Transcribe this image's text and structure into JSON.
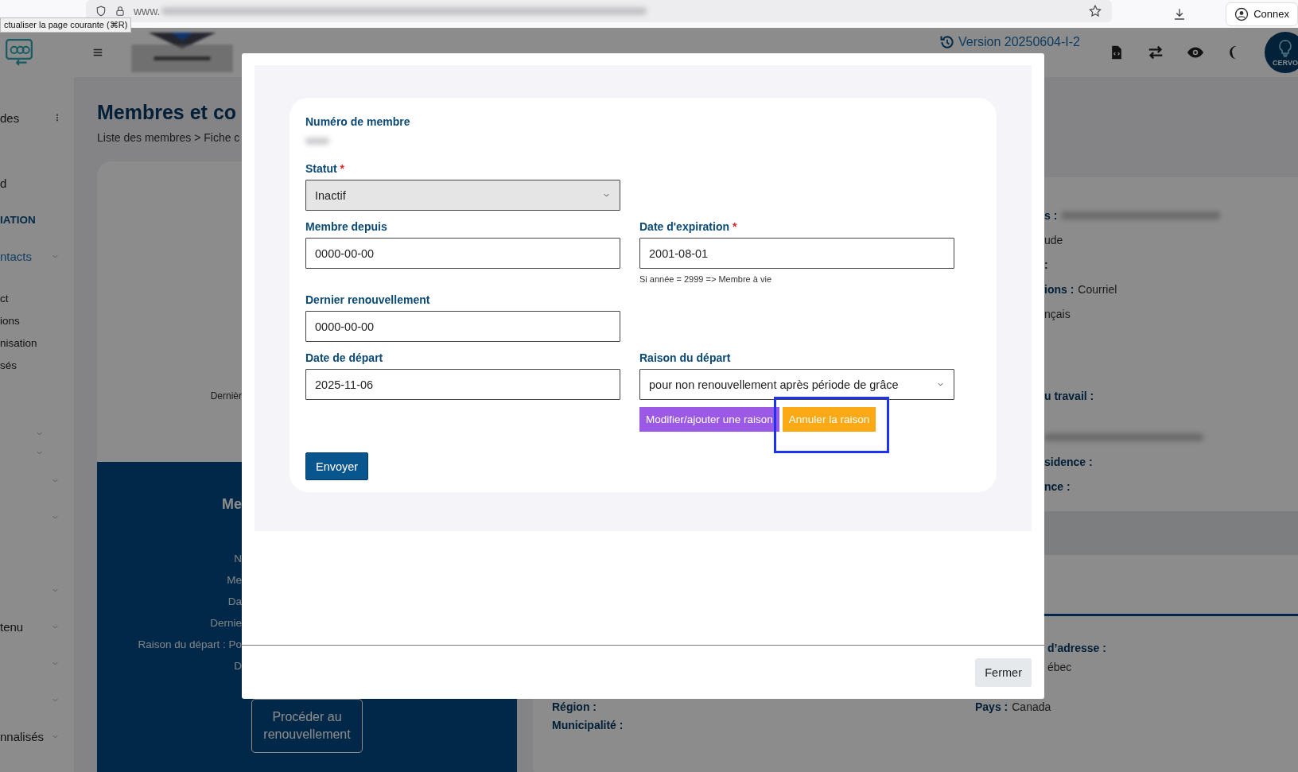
{
  "browser": {
    "url_prefix": "www.",
    "tooltip": "ctualiser la page courante (⌘R)",
    "profile_label": "Connex"
  },
  "header": {
    "version": "Version 20250604-I-2",
    "avatar_label": "CERVO"
  },
  "sidebar": {
    "items": [
      {
        "kind": "menu",
        "label": "des",
        "more": true
      },
      {
        "kind": "item",
        "label": "d"
      },
      {
        "kind": "section",
        "label": "IATION"
      },
      {
        "kind": "item",
        "label": "ntacts",
        "expandable": true,
        "selected": true
      },
      {
        "kind": "sub",
        "label": "ct"
      },
      {
        "kind": "sub",
        "label": "ions"
      },
      {
        "kind": "sub",
        "label": "nisation"
      },
      {
        "kind": "sub",
        "label": "sés"
      },
      {
        "kind": "group",
        "expandable": true
      },
      {
        "kind": "group",
        "expandable": true
      },
      {
        "kind": "item",
        "expandable": true
      },
      {
        "kind": "item",
        "expandable": true
      },
      {
        "kind": "spacer"
      },
      {
        "kind": "item",
        "expandable": true
      },
      {
        "kind": "item",
        "label": "tenu",
        "expandable": true
      },
      {
        "kind": "item",
        "expandable": true
      },
      {
        "kind": "item",
        "expandable": true
      },
      {
        "kind": "item",
        "label": "nnalisés",
        "expandable": true
      }
    ]
  },
  "page": {
    "title": "Membres et co",
    "breadcrumb": "Liste des membres > Fiche c"
  },
  "profile_card": {
    "line": "Dernièr",
    "panel_title": "Me",
    "panel_lines": [
      "N",
      "Me",
      "Da",
      "Dernie",
      "Raison du départ : Po",
      "D"
    ],
    "renew_button": "Procéder au renouvellement"
  },
  "details": [
    {
      "kind": "blurred",
      "label": "s :"
    },
    {
      "kind": "value",
      "value": "ude"
    },
    {
      "kind": "label",
      "label": ":"
    },
    {
      "kind": "label",
      "label": "ions :",
      "value": "Courriel"
    },
    {
      "kind": "value",
      "value": "nçais"
    },
    {
      "kind": "heading",
      "label": "u travail :"
    },
    {
      "kind": "blurred"
    },
    {
      "kind": "label",
      "label": "sidence :"
    },
    {
      "kind": "label",
      "label": "nce :"
    }
  ],
  "address": {
    "left": [
      {
        "label": "Région :"
      },
      {
        "label": "Municipalité :"
      }
    ],
    "right_top": [
      {
        "label": "d’adresse :"
      },
      {
        "value": "ébec"
      }
    ],
    "right": [
      {
        "label": "Pays :",
        "value": "Canada"
      }
    ]
  },
  "modal": {
    "member_number": {
      "label": "Numéro de membre"
    },
    "rows": [
      [
        {
          "kind": "select",
          "label": "Statut",
          "required": true,
          "value": "Inactif",
          "disabled": true
        }
      ],
      [
        {
          "kind": "input",
          "label": "Membre depuis",
          "required": false,
          "value": "0000-00-00"
        },
        {
          "kind": "input",
          "label": "Date d'expiration",
          "required": true,
          "value": "2001-08-01",
          "hint": "Si année = 2999 => Membre à vie"
        }
      ],
      [
        {
          "kind": "input",
          "label": "Dernier renouvellement",
          "required": false,
          "value": "0000-00-00"
        }
      ],
      [
        {
          "kind": "input",
          "label": "Date de départ",
          "required": false,
          "value": "2025-11-06"
        },
        {
          "kind": "select",
          "label": "Raison du départ",
          "required": false,
          "value": "pour non renouvellement après période de grâce",
          "disabled": false,
          "actions": [
            {
              "kind": "secondary",
              "label": "Modifier/ajouter une raison",
              "highlighted": false
            },
            {
              "kind": "warning",
              "label": "Annuler la raison",
              "highlighted": true
            }
          ]
        }
      ]
    ],
    "required_mark": "*",
    "submit": "Envoyer",
    "close": "Fermer"
  }
}
